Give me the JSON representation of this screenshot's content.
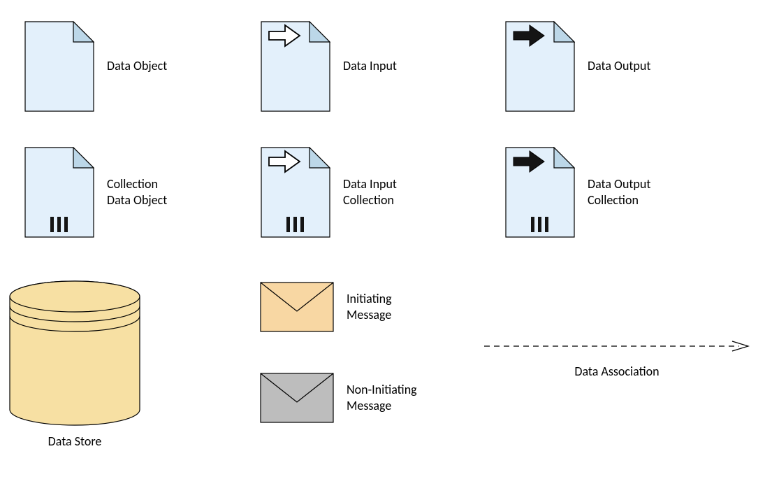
{
  "labels": {
    "data_object": "Data Object",
    "data_input": "Data Input",
    "data_output": "Data Output",
    "collection_data_object_line1": "Collection",
    "collection_data_object_line2": "Data Object",
    "data_input_collection_line1": "Data Input",
    "data_input_collection_line2": "Collection",
    "data_output_collection_line1": "Data Output",
    "data_output_collection_line2": "Collection",
    "initiating_message_line1": "Initiating",
    "initiating_message_line2": "Message",
    "non_initiating_message_line1": "Non-Initiating",
    "non_initiating_message_line2": "Message",
    "data_store": "Data Store",
    "data_association": "Data Association"
  },
  "colors": {
    "doc_fill": "#e3f0fb",
    "doc_stroke": "#000000",
    "store_fill": "#f7e0a3",
    "store_stroke": "#000000",
    "envelope_init_fill": "#f8d7a3",
    "envelope_noninit_fill": "#bdbdbd",
    "envelope_stroke": "#000000"
  }
}
